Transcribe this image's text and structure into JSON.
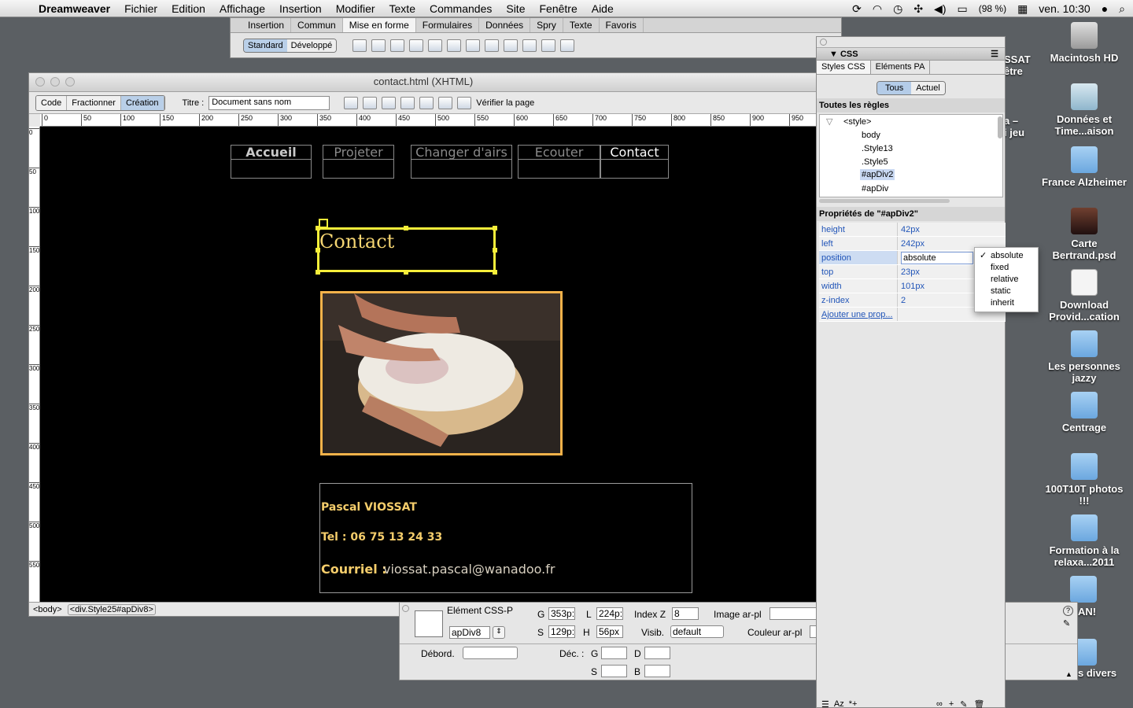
{
  "menubar": {
    "app": "Dreamweaver",
    "items": [
      "Fichier",
      "Edition",
      "Affichage",
      "Insertion",
      "Modifier",
      "Texte",
      "Commandes",
      "Site",
      "Fenêtre",
      "Aide"
    ],
    "battery": "(98 %)",
    "clock": "ven. 10:30"
  },
  "desktop": {
    "icons": [
      {
        "label": "Macintosh HD",
        "icon": "hard-drive-icon"
      },
      {
        "label": "Données et Time...aison",
        "icon": "time-machine-icon"
      },
      {
        "label": "France Alzheimer",
        "icon": "folder-icon"
      },
      {
        "label": "Carte Bertrand.psd",
        "icon": "psd-file-icon"
      },
      {
        "label": "Download Provid...cation",
        "icon": "web-document-icon"
      },
      {
        "label": "Les personnes jazzy",
        "icon": "folder-icon"
      },
      {
        "label": "Centrage",
        "icon": "folder-icon"
      },
      {
        "label": "100T10T photos !!!",
        "icon": "folder-icon"
      },
      {
        "label": "Formation à la relaxa...2011",
        "icon": "folder-icon"
      }
    ],
    "partial_labels": [
      "SSAT",
      "être",
      "a –",
      "i jeu",
      "AN!",
      "s divers"
    ]
  },
  "insertbar": {
    "tabs": [
      "Insertion",
      "Commun",
      "Mise en forme",
      "Formulaires",
      "Données",
      "Spry",
      "Texte",
      "Favoris"
    ],
    "active_tab": "Mise en forme",
    "modes": [
      "Standard",
      "Développé"
    ]
  },
  "document": {
    "window_title": "contact.html (XHTML)",
    "views": [
      "Code",
      "Fractionner",
      "Création"
    ],
    "title_label": "Titre :",
    "title_value": "Document sans nom",
    "check_page": "Vérifier la page",
    "ruler_h": [
      "0",
      "50",
      "100",
      "150",
      "200",
      "250",
      "300",
      "350",
      "400",
      "450",
      "500",
      "550",
      "600",
      "650",
      "700",
      "750",
      "800",
      "850",
      "900",
      "950"
    ],
    "ruler_v": [
      "0",
      "50",
      "100",
      "150",
      "200",
      "250",
      "300",
      "350",
      "400",
      "450",
      "500",
      "550"
    ],
    "nav": [
      "Accueil",
      "Projeter",
      "Changer d'airs",
      "Ecouter",
      "Contact"
    ],
    "heading": "Contact",
    "contact_name": "Pascal VIOSSAT",
    "contact_tel": "Tel : 06 75 13 24 33",
    "contact_mail_label": "Courriel :",
    "contact_mail": "viossat.pascal@wanadoo.fr",
    "status_tags": [
      "<body>",
      "<div.Style25#apDiv8>"
    ]
  },
  "properties": {
    "element_label": "Elément CSS-P",
    "element_id": "apDiv8",
    "g_label": "G",
    "g_value": "353p:",
    "l_label": "L",
    "l_value": "224p:",
    "zindex_label": "Index Z",
    "zindex_value": "8",
    "bgimage_label": "Image ar-pl",
    "s_label": "S",
    "s_value": "129p:",
    "h_label": "H",
    "h_value": "56px",
    "visib_label": "Visib.",
    "visib_value": "default",
    "bgcolor_label": "Couleur ar-pl",
    "overflow_label": "Débord.",
    "clip_label": "Déc. :",
    "clip_g": "G",
    "clip_d": "D",
    "clip_s": "S",
    "clip_b": "B"
  },
  "css_panel": {
    "title": "CSS",
    "tabs": [
      "Styles CSS",
      "Eléments PA"
    ],
    "modes": [
      "Tous",
      "Actuel"
    ],
    "all_rules_label": "Toutes les règles",
    "rules": [
      "<style>",
      "body",
      ".Style13",
      ".Style5",
      "#apDiv2",
      "#apDiv"
    ],
    "selected_rule": "#apDiv2",
    "props_header": "Propriétés de \"#apDiv2\"",
    "props": [
      {
        "k": "height",
        "v": "42px"
      },
      {
        "k": "left",
        "v": "242px"
      },
      {
        "k": "position",
        "v": "absolute"
      },
      {
        "k": "top",
        "v": "23px"
      },
      {
        "k": "width",
        "v": "101px"
      },
      {
        "k": "z-index",
        "v": "2"
      }
    ],
    "add_prop": "Ajouter une prop..."
  },
  "dropdown": {
    "options": [
      "absolute",
      "fixed",
      "relative",
      "static",
      "inherit"
    ],
    "checked": "absolute",
    "check_glyph": "✓"
  }
}
